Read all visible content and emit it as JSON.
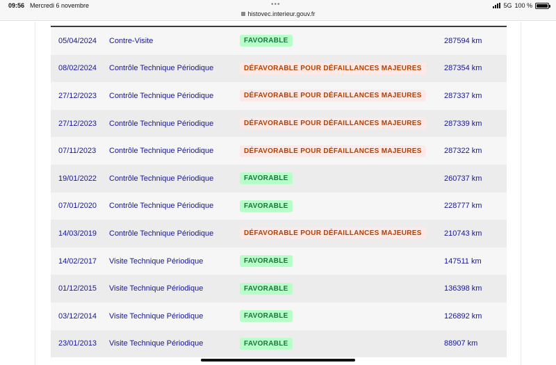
{
  "status_bar": {
    "time": "09:56",
    "date": "Mercredi 6 novembre",
    "url": "histovec.interieur.gouv.fr",
    "network": "5G",
    "battery": "100 %"
  },
  "colors": {
    "text_blue": "#161694",
    "favorable_bg": "#b8fec9",
    "favorable_text": "#18753c",
    "defavorable_bg": "#ffe9e6",
    "defavorable_text": "#b34000"
  },
  "rows": [
    {
      "date": "05/04/2024",
      "type": "Contre-Visite",
      "result": "FAVORABLE",
      "status": "ok",
      "km": "287594 km"
    },
    {
      "date": "08/02/2024",
      "type": "Contrôle Technique Périodique",
      "result": "DÉFAVORABLE POUR DÉFAILLANCES MAJEURES",
      "status": "ko",
      "km": "287354 km"
    },
    {
      "date": "27/12/2023",
      "type": "Contrôle Technique Périodique",
      "result": "DÉFAVORABLE POUR DÉFAILLANCES MAJEURES",
      "status": "ko",
      "km": "287337 km"
    },
    {
      "date": "27/12/2023",
      "type": "Contrôle Technique Périodique",
      "result": "DÉFAVORABLE POUR DÉFAILLANCES MAJEURES",
      "status": "ko",
      "km": "287339 km"
    },
    {
      "date": "07/11/2023",
      "type": "Contrôle Technique Périodique",
      "result": "DÉFAVORABLE POUR DÉFAILLANCES MAJEURES",
      "status": "ko",
      "km": "287322 km"
    },
    {
      "date": "19/01/2022",
      "type": "Contrôle Technique Périodique",
      "result": "FAVORABLE",
      "status": "ok",
      "km": "260737 km"
    },
    {
      "date": "07/01/2020",
      "type": "Contrôle Technique Périodique",
      "result": "FAVORABLE",
      "status": "ok",
      "km": "228777 km"
    },
    {
      "date": "14/03/2019",
      "type": "Contrôle Technique Périodique",
      "result": "DÉFAVORABLE POUR DÉFAILLANCES MAJEURES",
      "status": "ko",
      "km": "210743 km"
    },
    {
      "date": "14/02/2017",
      "type": "Visite Technique Périodique",
      "result": "FAVORABLE",
      "status": "ok",
      "km": "147511 km"
    },
    {
      "date": "01/12/2015",
      "type": "Visite Technique Périodique",
      "result": "FAVORABLE",
      "status": "ok",
      "km": "136398 km"
    },
    {
      "date": "03/12/2014",
      "type": "Visite Technique Périodique",
      "result": "FAVORABLE",
      "status": "ok",
      "km": "126892 km"
    },
    {
      "date": "23/01/2013",
      "type": "Visite Technique Périodique",
      "result": "FAVORABLE",
      "status": "ok",
      "km": "88907 km"
    }
  ]
}
